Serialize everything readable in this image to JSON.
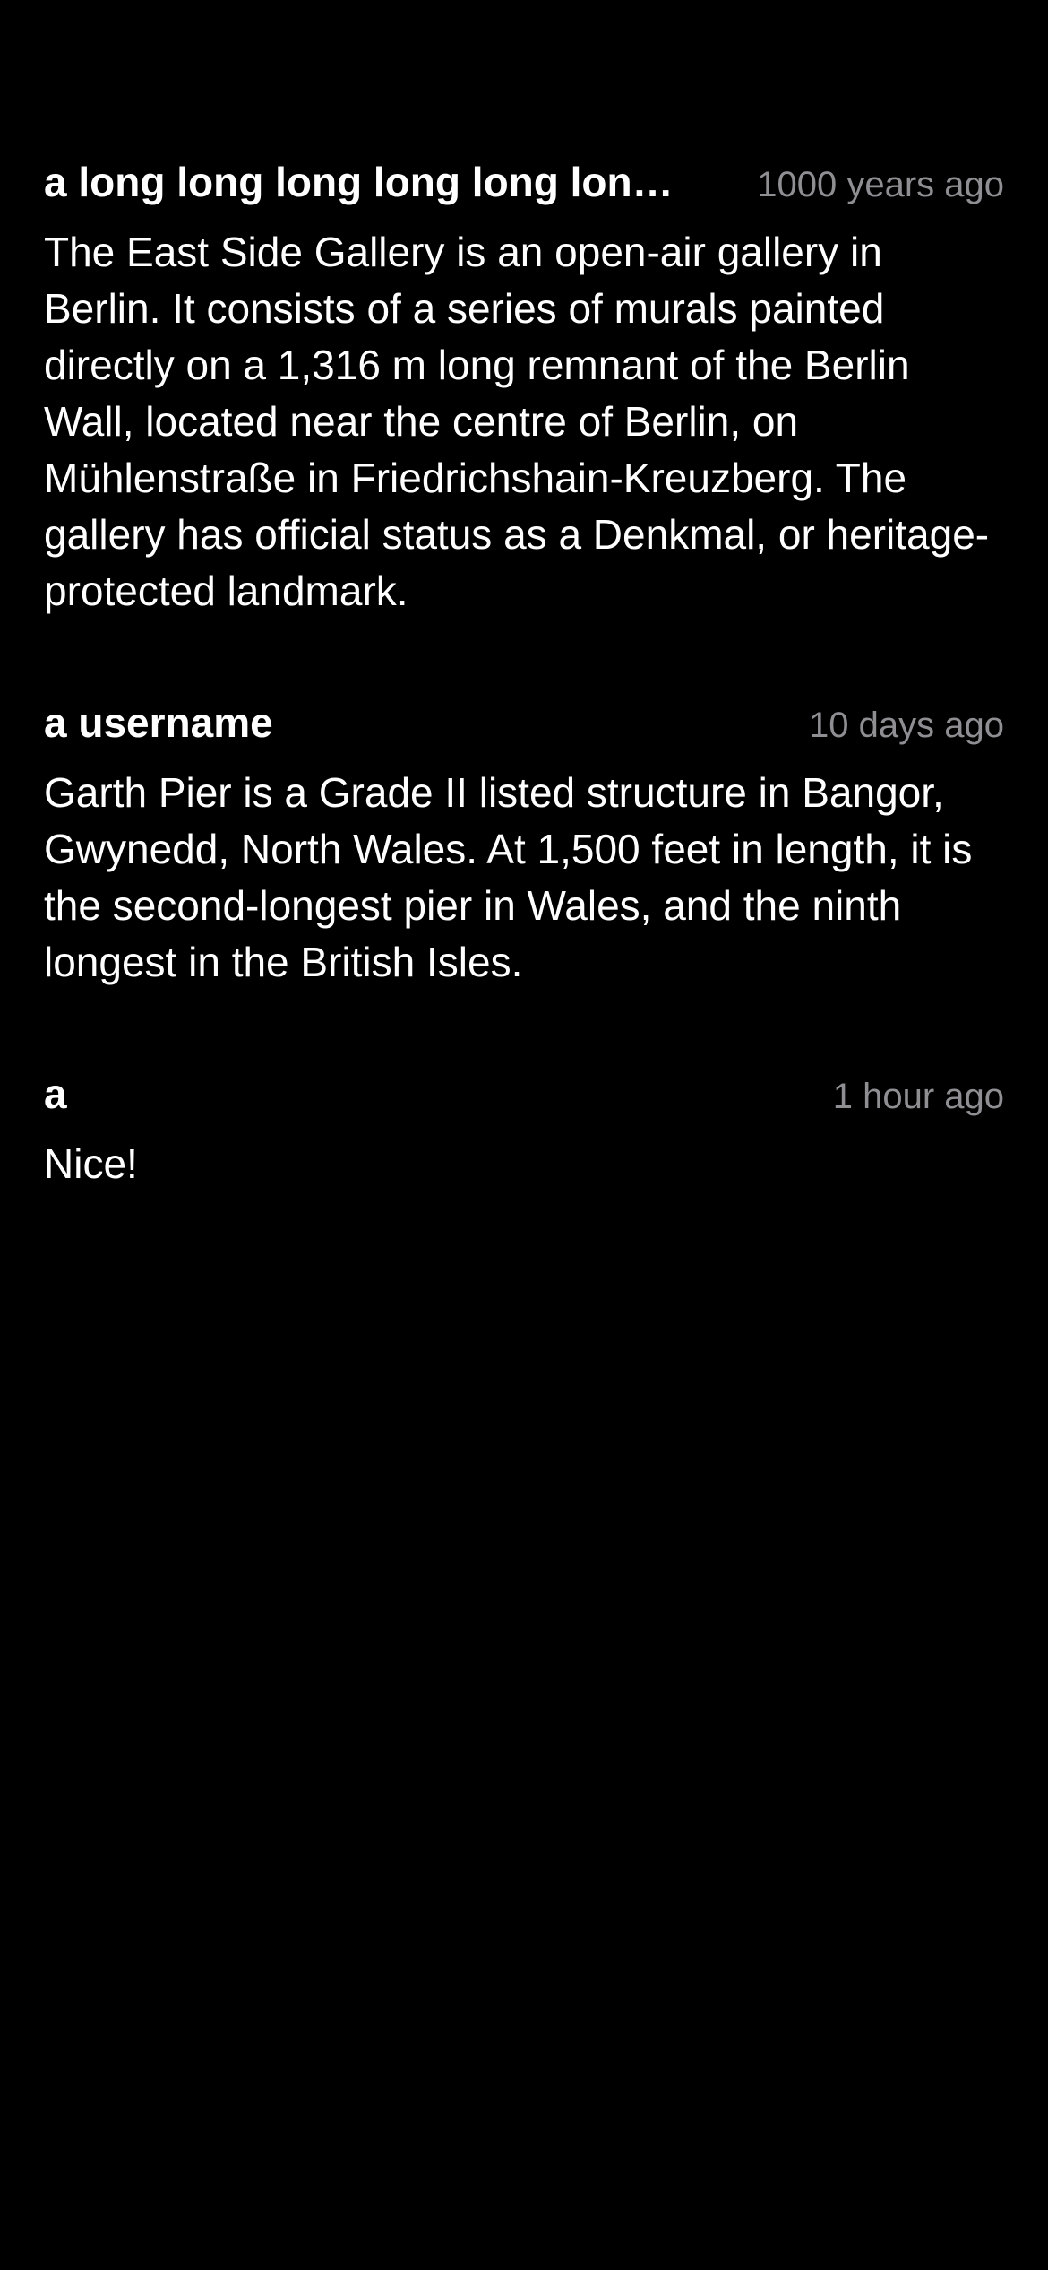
{
  "colors": {
    "background": "#000000",
    "text": "#ffffff",
    "timestamp": "#8e8e93"
  },
  "comments": [
    {
      "username": "a long long long long long long long long long username",
      "timestamp": "1000 years ago",
      "body": "The East Side Gallery is an open-air gallery in Berlin. It consists of a series of murals painted directly on a 1,316 m long remnant of the Berlin Wall, located near the centre of Berlin, on Mühlenstraße in Friedrichshain-Kreuzberg. The gallery has official status as a Denkmal, or heritage-protected landmark."
    },
    {
      "username": "a username",
      "timestamp": "10 days ago",
      "body": "Garth Pier is a Grade II listed structure in Bangor, Gwynedd, North Wales. At 1,500 feet in length, it is the second-longest pier in Wales, and the ninth longest in the British Isles."
    },
    {
      "username": "a",
      "timestamp": "1 hour ago",
      "body": "Nice!"
    }
  ]
}
